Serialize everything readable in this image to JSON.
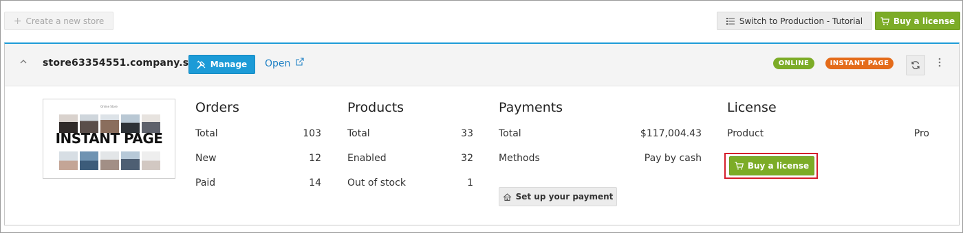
{
  "toolbar": {
    "create_store_label": "Create a new store",
    "switch_production_label": "Switch to Production - Tutorial",
    "buy_license_label": "Buy a license"
  },
  "store": {
    "name": "store63354551.company.site",
    "manage_label": "Manage",
    "open_label": "Open",
    "badges": {
      "online": "ONLINE",
      "instant_page": "INSTANT PAGE"
    },
    "thumbnail": {
      "title": "Online Store",
      "overlay_text": "INSTANT PAGE"
    }
  },
  "orders": {
    "title": "Orders",
    "rows": [
      {
        "label": "Total",
        "value": "103"
      },
      {
        "label": "New",
        "value": "12"
      },
      {
        "label": "Paid",
        "value": "14"
      }
    ]
  },
  "products": {
    "title": "Products",
    "rows": [
      {
        "label": "Total",
        "value": "33"
      },
      {
        "label": "Enabled",
        "value": "32"
      },
      {
        "label": "Out of stock",
        "value": "1"
      }
    ]
  },
  "payments": {
    "title": "Payments",
    "rows": [
      {
        "label": "Total",
        "value": "$117,004.43"
      },
      {
        "label": "Methods",
        "value": "Pay by cash"
      }
    ],
    "setup_label": "Set up your payment"
  },
  "license": {
    "title": "License",
    "product_label": "Product",
    "product_value": "Pro",
    "buy_label": "Buy a license"
  },
  "colors": {
    "accent_blue": "#1c9bd7",
    "green": "#7cac27",
    "orange": "#e46b1a",
    "highlight_red": "#d51d2b"
  }
}
